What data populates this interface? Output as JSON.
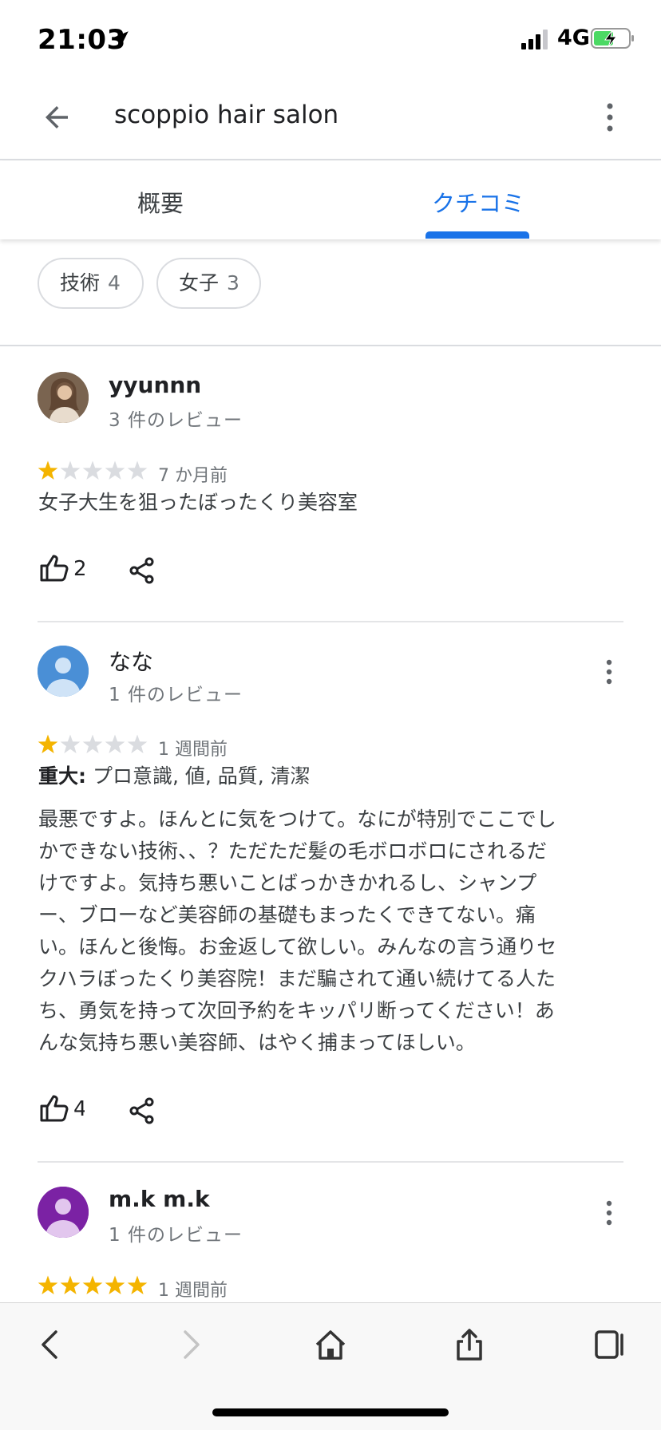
{
  "status_bar": {
    "time": "21:03",
    "network": "4G",
    "icons": [
      "location-arrow-icon",
      "signal-icon",
      "battery-charging-icon"
    ]
  },
  "header": {
    "title": "scoppio hair salon",
    "icons": [
      "back-arrow-icon",
      "more-vert-icon"
    ]
  },
  "tabs": [
    {
      "label": "概要",
      "selected": false
    },
    {
      "label": "クチコミ",
      "selected": true
    }
  ],
  "filter_chips": [
    {
      "label": "技術",
      "count": "4"
    },
    {
      "label": "女子",
      "count": "3"
    }
  ],
  "reviews": [
    {
      "name": "yyunnn",
      "review_count": "3 件のレビュー",
      "rating": 1,
      "time": "7 か月前",
      "text": "女子大生を狙ったぼったくり美容室",
      "likes": "2"
    },
    {
      "name": "なな",
      "review_count": "1 件のレビュー",
      "rating": 1,
      "time": "1 週間前",
      "tags_label": "重大:",
      "tags": "プロ意識, 値, 品質, 清潔",
      "text_lines": [
        "最悪ですよ。ほんとに気をつけて。なにが特別でここでし",
        "かできない技術、、？ただただ髪の毛ボロボロにされるだ",
        "けですよ。気持ち悪いことばっかきかれるし、シャンプ",
        "ー、ブローなど美容師の基礎もまったくできてない。痛",
        "い。ほんと後悔。お金返して欲しい。みんなの言う通りセ",
        "クハラぼったくり美容院！まだ騙されて通い続けてる人た",
        "ち、勇気を持って次回予約をキッパリ断ってください！あ",
        "んな気持ち悪い美容師、はやく捕まってほしい。"
      ],
      "likes": "4"
    },
    {
      "name": "m.k m.k",
      "review_count": "1 件のレビュー",
      "rating": 5,
      "time": "1 週間前"
    }
  ],
  "toolbar": {
    "icons": [
      "back-icon",
      "forward-icon",
      "home-icon",
      "share-icon",
      "tabs-icon"
    ]
  },
  "colors": {
    "accent": "#1a73e8",
    "star_filled": "#f4b400",
    "star_empty": "#dadce0"
  }
}
